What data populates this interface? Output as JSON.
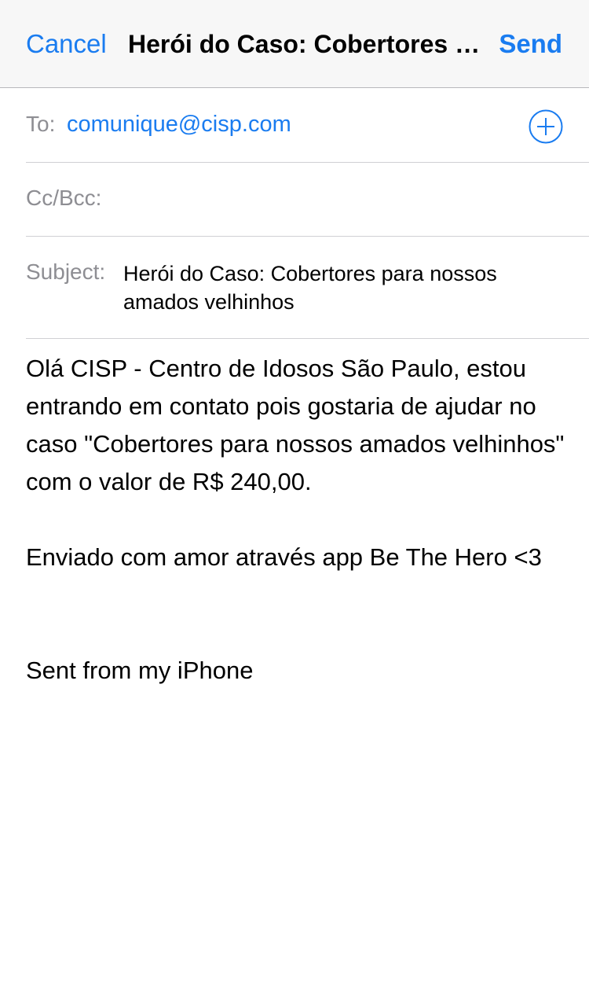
{
  "navbar": {
    "cancel_label": "Cancel",
    "title": "Herói do Caso: Cobertores para nossos amados velhinhos",
    "send_label": "Send"
  },
  "fields": {
    "to_label": "To:",
    "to_value": "comunique@cisp.com",
    "add_icon": "plus-circle-icon",
    "cc_label": "Cc/Bcc:",
    "subject_label": "Subject:",
    "subject_value": "Herói do Caso: Cobertores para nossos amados velhinhos"
  },
  "body": {
    "paragraph_1": "Olá CISP - Centro de Idosos São Paulo, estou entrando em contato pois gostaria de ajudar no caso \"Cobertores para nossos amados velhinhos\" com o valor de R$ 240,00.",
    "paragraph_2": "Enviado com amor através app Be The Hero <3",
    "signature": "Sent from my iPhone"
  },
  "colors": {
    "accent": "#1a7cf0",
    "label_gray": "#8e8e93",
    "navbar_bg": "#f7f7f7"
  }
}
